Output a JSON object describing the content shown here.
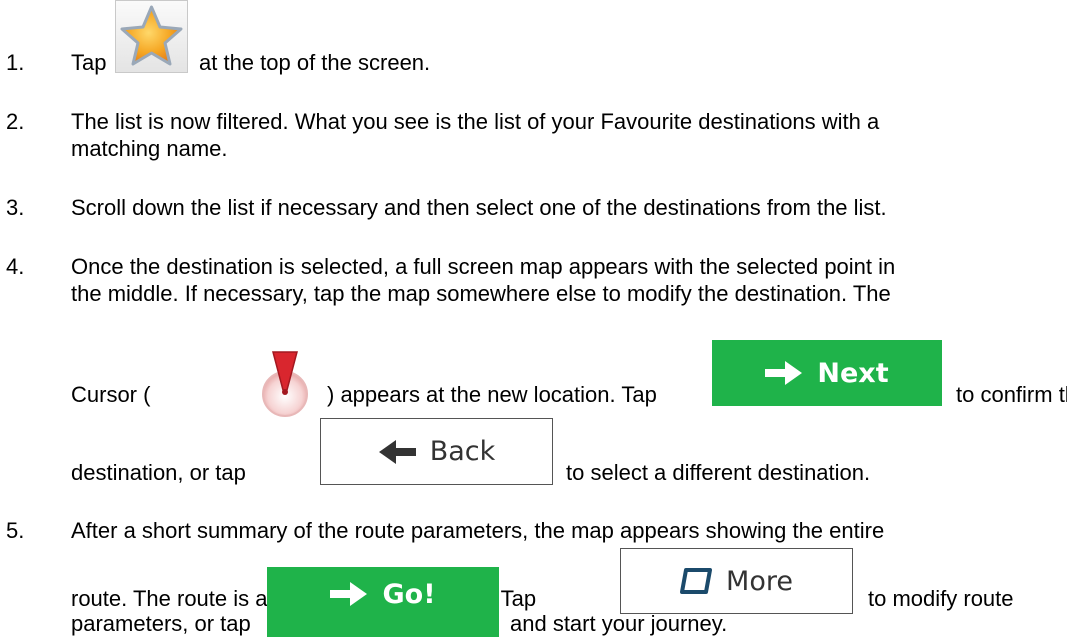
{
  "steps": [
    {
      "number": "1.",
      "lines": [
        "Tap",
        "at the top of the screen."
      ]
    },
    {
      "number": "2.",
      "lines": [
        "The list is now filtered. What you see is the list of your Favourite destinations with a",
        "matching name."
      ]
    },
    {
      "number": "3.",
      "lines": [
        "Scroll down the list if necessary and then select one of the destinations from the list."
      ]
    },
    {
      "number": "4.",
      "lines": [
        "Once the destination is selected, a full screen map appears with the selected point in",
        "the middle. If necessary, tap the map somewhere else to modify the destination. The",
        "Cursor (",
        ") appears at the new location. Tap",
        "to confirm the",
        "destination, or tap",
        "to select a different destination."
      ]
    },
    {
      "number": "5.",
      "lines": [
        "After a short summary of the route parameters, the map appears showing the entire",
        "route. The route is automatically calculated. Tap",
        "to modify route",
        "parameters, or tap",
        "and start your journey."
      ]
    }
  ],
  "buttons": {
    "next": "Next",
    "back": "Back",
    "more": "More",
    "go": "Go!"
  },
  "icons": [
    "favourites-star-icon",
    "map-cursor-icon",
    "arrow-right-icon",
    "arrow-left-icon",
    "more-icon"
  ],
  "colors": {
    "green_button": "#1fb34a",
    "text": "#000000"
  }
}
